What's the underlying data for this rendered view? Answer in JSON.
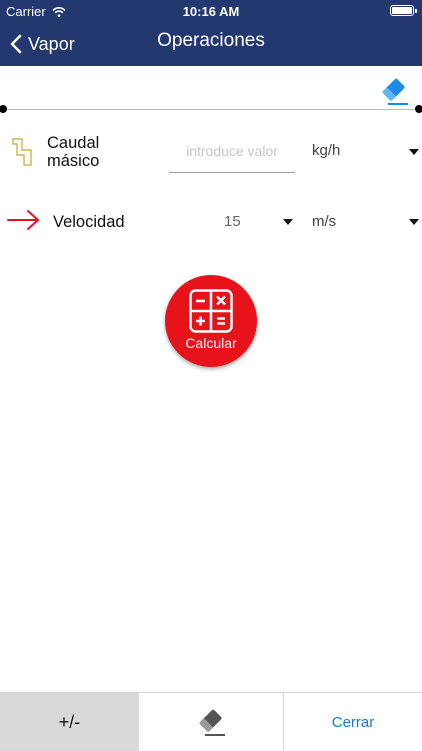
{
  "status": {
    "carrier": "Carrier",
    "time": "10:16 AM"
  },
  "nav": {
    "back_label": "Vapor",
    "title": "Operaciones"
  },
  "rows": [
    {
      "label": "Caudal másico",
      "label_line1": "Caudal",
      "label_line2": "másico",
      "placeholder": "introduce valor",
      "value": "",
      "unit": "kg/h",
      "icon": "pipe-segment-icon"
    },
    {
      "label": "Velocidad",
      "value": "15",
      "unit": "m/s",
      "icon": "arrow-right-icon"
    }
  ],
  "calc_button": {
    "label": "Calcular"
  },
  "bottom": {
    "sign_label": "+/-",
    "close_label": "Cerrar"
  },
  "colors": {
    "navbar": "#23386e",
    "accent_red": "#e8121a",
    "link_blue": "#1976d2",
    "eraser_blue": "#1e88e5"
  }
}
